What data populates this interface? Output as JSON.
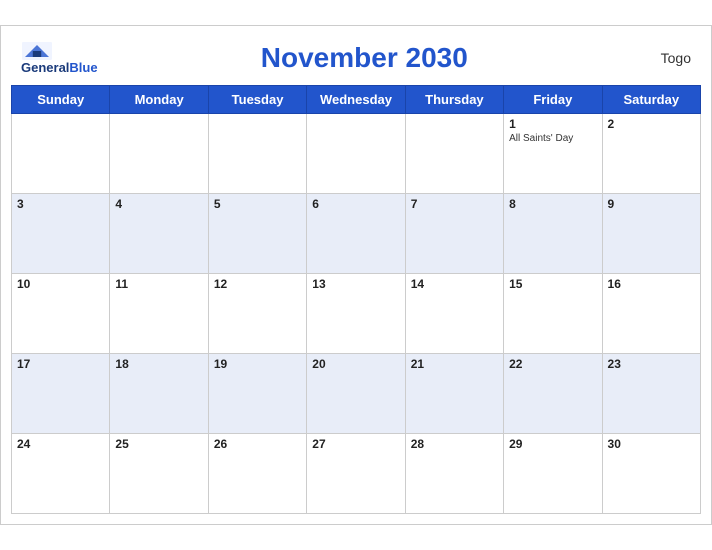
{
  "header": {
    "logo_line1": "General",
    "logo_line2": "Blue",
    "title": "November 2030",
    "country": "Togo"
  },
  "weekdays": [
    "Sunday",
    "Monday",
    "Tuesday",
    "Wednesday",
    "Thursday",
    "Friday",
    "Saturday"
  ],
  "weeks": [
    [
      {
        "day": "",
        "event": ""
      },
      {
        "day": "",
        "event": ""
      },
      {
        "day": "",
        "event": ""
      },
      {
        "day": "",
        "event": ""
      },
      {
        "day": "",
        "event": ""
      },
      {
        "day": "1",
        "event": "All Saints' Day"
      },
      {
        "day": "2",
        "event": ""
      }
    ],
    [
      {
        "day": "3",
        "event": ""
      },
      {
        "day": "4",
        "event": ""
      },
      {
        "day": "5",
        "event": ""
      },
      {
        "day": "6",
        "event": ""
      },
      {
        "day": "7",
        "event": ""
      },
      {
        "day": "8",
        "event": ""
      },
      {
        "day": "9",
        "event": ""
      }
    ],
    [
      {
        "day": "10",
        "event": ""
      },
      {
        "day": "11",
        "event": ""
      },
      {
        "day": "12",
        "event": ""
      },
      {
        "day": "13",
        "event": ""
      },
      {
        "day": "14",
        "event": ""
      },
      {
        "day": "15",
        "event": ""
      },
      {
        "day": "16",
        "event": ""
      }
    ],
    [
      {
        "day": "17",
        "event": ""
      },
      {
        "day": "18",
        "event": ""
      },
      {
        "day": "19",
        "event": ""
      },
      {
        "day": "20",
        "event": ""
      },
      {
        "day": "21",
        "event": ""
      },
      {
        "day": "22",
        "event": ""
      },
      {
        "day": "23",
        "event": ""
      }
    ],
    [
      {
        "day": "24",
        "event": ""
      },
      {
        "day": "25",
        "event": ""
      },
      {
        "day": "26",
        "event": ""
      },
      {
        "day": "27",
        "event": ""
      },
      {
        "day": "28",
        "event": ""
      },
      {
        "day": "29",
        "event": ""
      },
      {
        "day": "30",
        "event": ""
      }
    ]
  ],
  "colors": {
    "header_bg": "#2255cc",
    "even_row_bg": "#e8edf8",
    "title_color": "#2255cc"
  }
}
